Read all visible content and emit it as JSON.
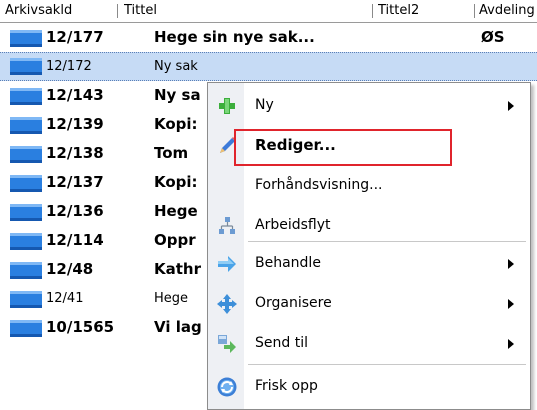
{
  "columns": {
    "arkivsakid": "Arkivsakld",
    "tittel": "Tittel",
    "tittel2": "Tittel2",
    "avdeling": "Avdeling"
  },
  "rows": [
    {
      "id": "12/177",
      "title": "Hege sin nye sak...",
      "dept": "ØS",
      "bold": true
    },
    {
      "id": "12/172",
      "title": "Ny sak",
      "dept": "",
      "bold": false,
      "selected": true
    },
    {
      "id": "12/143",
      "title": "Ny sa",
      "dept": "",
      "bold": true
    },
    {
      "id": "12/139",
      "title": "Kopi:",
      "dept": "",
      "bold": true
    },
    {
      "id": "12/138",
      "title": "Tom",
      "dept": "",
      "bold": true
    },
    {
      "id": "12/137",
      "title": "Kopi:",
      "dept": "",
      "bold": true
    },
    {
      "id": "12/136",
      "title": "Hege",
      "dept": "",
      "bold": true
    },
    {
      "id": "12/114",
      "title": "Oppr",
      "dept": "",
      "bold": true
    },
    {
      "id": "12/48",
      "title": "Kathr",
      "dept": "",
      "bold": true
    },
    {
      "id": "12/41",
      "title": "Hege",
      "dept": "",
      "bold": false
    },
    {
      "id": "10/1565",
      "title": "Vi lag",
      "dept": "",
      "bold": true
    }
  ],
  "context_menu": {
    "items": [
      {
        "label": "Ny",
        "icon": "green-plus-icon",
        "submenu": true
      },
      {
        "label": "Rediger...",
        "icon": "pencil-icon",
        "submenu": false,
        "bold": true,
        "highlighted": true
      },
      {
        "label": "Forhåndsvisning...",
        "icon": "",
        "submenu": false
      },
      {
        "label": "Arbeidsflyt",
        "icon": "workflow-icon",
        "submenu": false
      },
      {
        "label": "Behandle",
        "icon": "arrow-icon",
        "submenu": true
      },
      {
        "label": "Organisere",
        "icon": "organize-icon",
        "submenu": true
      },
      {
        "label": "Send til",
        "icon": "send-to-icon",
        "submenu": true
      },
      {
        "label": "Frisk opp",
        "icon": "refresh-icon",
        "submenu": false
      }
    ]
  },
  "colors": {
    "selection": "#c6dbf5",
    "highlight_box": "#e0242c",
    "folder": "#2a7fe0"
  }
}
